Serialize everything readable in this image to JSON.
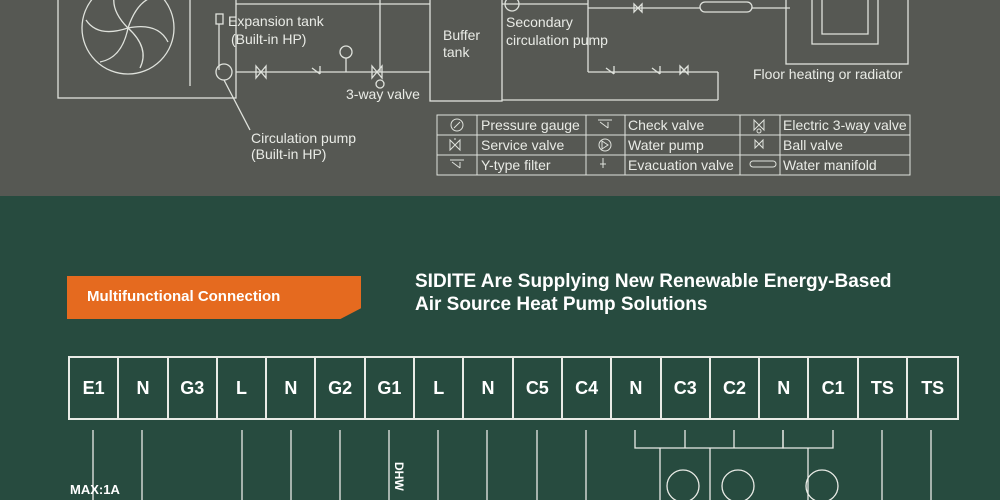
{
  "diagram": {
    "labels": {
      "expansion_tank": "Expansion tank",
      "builtin_1": "(Built-in HP)",
      "buffer_1": "Buffer",
      "buffer_2": "tank",
      "secondary_1": "Secondary",
      "secondary_2": "circulation pump",
      "floor": "Floor heating or radiator",
      "three_way": "3-way valve",
      "circ_pump": "Circulation pump",
      "builtin_2": "(Built-in HP)"
    },
    "legend": [
      {
        "icon": "pressure-gauge-icon",
        "label": "Pressure gauge"
      },
      {
        "icon": "check-valve-icon",
        "label": "Check valve"
      },
      {
        "icon": "electric-3-way-valve-icon",
        "label": "Electric 3-way valve"
      },
      {
        "icon": "service-valve-icon",
        "label": "Service valve"
      },
      {
        "icon": "water-pump-icon",
        "label": "Water pump"
      },
      {
        "icon": "ball-valve-icon",
        "label": "Ball valve"
      },
      {
        "icon": "y-type-filter-icon",
        "label": "Y-type filter"
      },
      {
        "icon": "evacuation-valve-icon",
        "label": "Evacuation valve"
      },
      {
        "icon": "water-manifold-icon",
        "label": "Water manifold"
      }
    ]
  },
  "section": {
    "banner": "Multifunctional Connection",
    "headline_1": "SIDITE Are Supplying New Renewable Energy-Based",
    "headline_2": "Air Source Heat Pump Solutions"
  },
  "terminals": [
    "E1",
    "N",
    "G3",
    "L",
    "N",
    "G2",
    "G1",
    "L",
    "N",
    "C5",
    "C4",
    "N",
    "C3",
    "C2",
    "N",
    "C1",
    "TS",
    "TS"
  ],
  "wiring": {
    "max": "MAX:1A",
    "dhw": "DHW"
  },
  "colors": {
    "top_bg": "#565853",
    "bottom_bg": "#274b3f",
    "accent": "#e56a1f",
    "line": "#e9ebe6"
  }
}
